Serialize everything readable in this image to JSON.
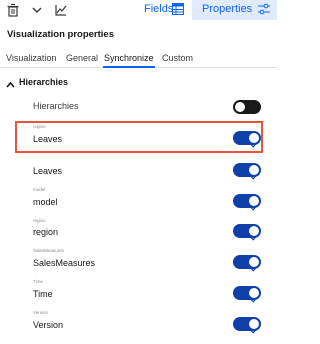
{
  "toolbar": {
    "icons": [
      "trash-icon",
      "chevron-down-icon",
      "chart-icon"
    ],
    "fields_label": "Fields",
    "properties_label": "Properties"
  },
  "panel": {
    "title": "Visualization properties"
  },
  "subtabs": [
    {
      "label": "Visualization",
      "active": false
    },
    {
      "label": "General",
      "active": false
    },
    {
      "label": "Synchronize",
      "active": true
    },
    {
      "label": "Custom",
      "active": false
    }
  ],
  "section": {
    "title": "Hierarchies",
    "hierarchies_label": "Hierarchies",
    "hierarchies_toggle": "off"
  },
  "items": [
    {
      "caption": "region",
      "label": "Leaves",
      "toggle": "on",
      "highlighted": true
    },
    {
      "caption": "",
      "label": "Leaves",
      "toggle": "on",
      "highlighted": false
    },
    {
      "caption": "model",
      "label": "model",
      "toggle": "on",
      "highlighted": false
    },
    {
      "caption": "region",
      "label": "region",
      "toggle": "on",
      "highlighted": false
    },
    {
      "caption": "SalesMeasures",
      "label": "SalesMeasures",
      "toggle": "on",
      "highlighted": false
    },
    {
      "caption": "Time",
      "label": "Time",
      "toggle": "on",
      "highlighted": false
    },
    {
      "caption": "Version",
      "label": "Version",
      "toggle": "on",
      "highlighted": false
    }
  ],
  "colors": {
    "accent": "#0f62fe",
    "toggle_on": "#0f3fa8",
    "toggle_off": "#1a1a1a",
    "highlight": "#e8553d",
    "properties_tab_bg": "#e0ebff"
  }
}
